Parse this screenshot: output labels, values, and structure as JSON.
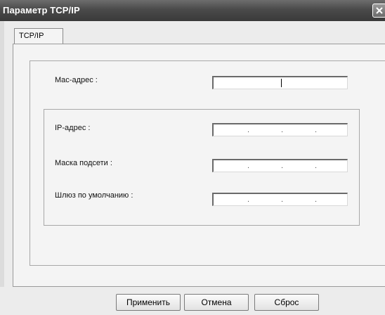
{
  "window": {
    "title": "Параметр TCP/IP"
  },
  "tabs": [
    {
      "label": "TCP/IP",
      "active": true
    }
  ],
  "fields": {
    "mac": {
      "label": "Mac-адрес :",
      "value": ""
    },
    "ip": {
      "label": "IP-адрес :",
      "value": ". . ."
    },
    "subnet": {
      "label": "Маска подсети :",
      "value": ". . ."
    },
    "gateway": {
      "label": "Шлюз по умолчанию :",
      "value": ". . ."
    }
  },
  "buttons": {
    "apply": "Применить",
    "cancel": "Отмена",
    "reset": "Сброс"
  },
  "icons": {
    "close": "close-icon"
  }
}
